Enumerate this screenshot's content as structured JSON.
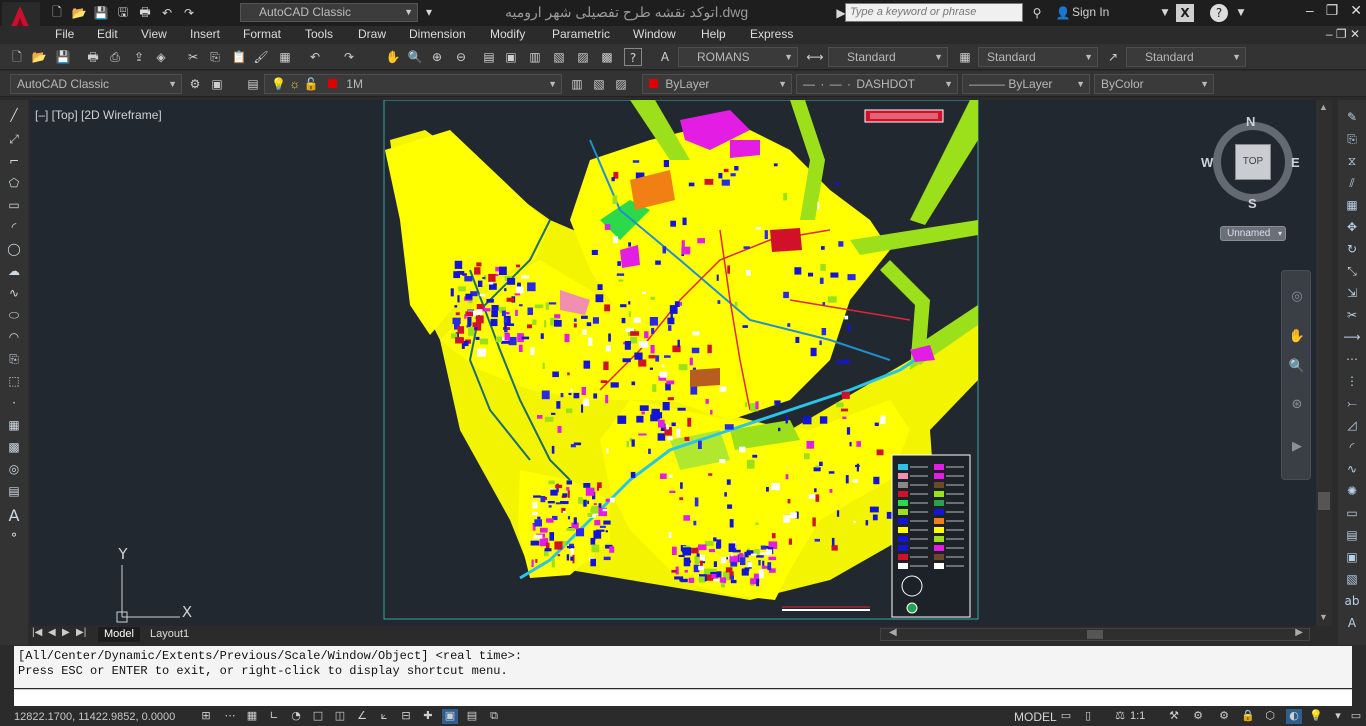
{
  "window": {
    "title": "اتوکد نقشه طرح تفصیلی شهر ارومیه.dwg",
    "workspace": "AutoCAD Classic",
    "search_placeholder": "Type a keyword or phrase",
    "sign_in": "Sign In"
  },
  "menu": [
    "File",
    "Edit",
    "View",
    "Insert",
    "Format",
    "Tools",
    "Draw",
    "Dimension",
    "Modify",
    "Parametric",
    "Window",
    "Help",
    "Express"
  ],
  "toolbar1": {
    "text_style": "ROMANS",
    "dim_style": "Standard",
    "table_style": "Standard",
    "mleader_style": "Standard"
  },
  "toolbar2": {
    "workspace": "AutoCAD Classic",
    "layer": "1M",
    "layer_color": "#e00000",
    "color": "ByLayer",
    "linetype": "DASHDOT",
    "lineweight": "ByLayer",
    "plotstyle": "ByColor"
  },
  "viewport": {
    "label": "[–] [Top] [2D Wireframe]",
    "viewcube_top": "TOP",
    "compass": {
      "n": "N",
      "s": "S",
      "e": "E",
      "w": "W"
    },
    "ucs_name": "Unnamed",
    "ucs_x": "X",
    "ucs_y": "Y",
    "background": "#212830"
  },
  "tabs": [
    {
      "label": "Model",
      "active": true
    },
    {
      "label": "Layout1",
      "active": false
    }
  ],
  "command": {
    "line1": "[All/Center/Dynamic/Extents/Previous/Scale/Window/Object] <real time>:",
    "line2": "Press ESC or ENTER to exit, or right-click to display shortcut menu."
  },
  "status": {
    "coords": "12822.1700, 11422.9852, 0.0000",
    "model": "MODEL",
    "scale": "1:1"
  }
}
